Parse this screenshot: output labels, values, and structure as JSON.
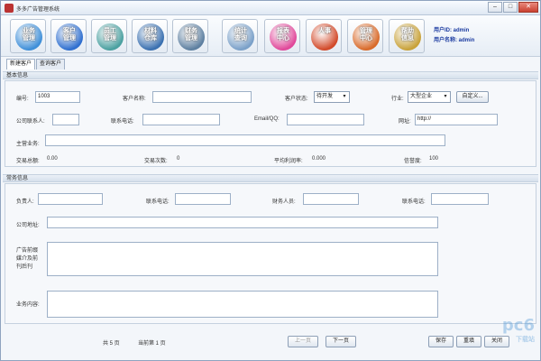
{
  "window": {
    "title": "多多广告管理系统"
  },
  "toolbar": {
    "items": [
      {
        "label": "业务管理",
        "color": "#3f8fd8"
      },
      {
        "label": "客户管理",
        "color": "#2f6fcf"
      },
      {
        "label": "员工管理",
        "color": "#4aa0a0"
      },
      {
        "label": "材料仓库",
        "color": "#3a70b0"
      },
      {
        "label": "财务管理",
        "color": "#5d7fa0"
      },
      {
        "label": "统计查询",
        "color": "#7aa0c8"
      },
      {
        "label": "报表中心",
        "color": "#e0489a"
      },
      {
        "label": "人事",
        "color": "#d24a2a"
      },
      {
        "label": "管理中心",
        "color": "#d86a2a"
      },
      {
        "label": "帮助信息",
        "color": "#c8a23a"
      }
    ],
    "user_id_label": "用户ID: admin",
    "user_name_label": "用户名称: admin"
  },
  "tabs": [
    {
      "label": "新建客户",
      "active": true
    },
    {
      "label": "查询客户",
      "active": false
    }
  ],
  "basic": {
    "section_title": "基本信息",
    "id_label": "编号:",
    "id_value": "1003",
    "name_label": "客户名称:",
    "name_value": "",
    "status_label": "客户状态:",
    "status_value": "待开发",
    "industry_label": "行业:",
    "industry_value": "大型企业",
    "custom_button": "自定义...",
    "contact_label": "公司联系人:",
    "phone_label": "联系电话:",
    "email_label": "Email/QQ:",
    "website_label": "网址:",
    "website_value": "http://",
    "main_business_label": "主营业务:",
    "amount_label": "交易总额:",
    "amount_value": "0.00",
    "count_label": "交易次数:",
    "count_value": "0",
    "avg_profit_label": "平均利润率:",
    "avg_profit_value": "0.000",
    "trust_label": "信誉度:",
    "trust_value": "100"
  },
  "common": {
    "section_title": "常务信息",
    "owner_label": "负责人:",
    "owner_phone_label": "联系电话:",
    "finance_label": "财务人员:",
    "finance_phone_label": "联系电话:",
    "address_label": "公司地址:",
    "ad_label": "广告前缀媒介及前刊后刊",
    "ad_line1": "广告前缀",
    "ad_line2": "媒介及前",
    "ad_line3": "刊后刊",
    "content_label": "业务内容:"
  },
  "footer": {
    "total_pages": "共 5 页",
    "current_page": "当前第 1 页",
    "prev_button": "上一页",
    "next_button": "下一页",
    "save_button": "保存",
    "reset_button": "重填",
    "close_button": "关闭"
  },
  "watermark": {
    "text": "pc6",
    "sub": "下载站"
  }
}
